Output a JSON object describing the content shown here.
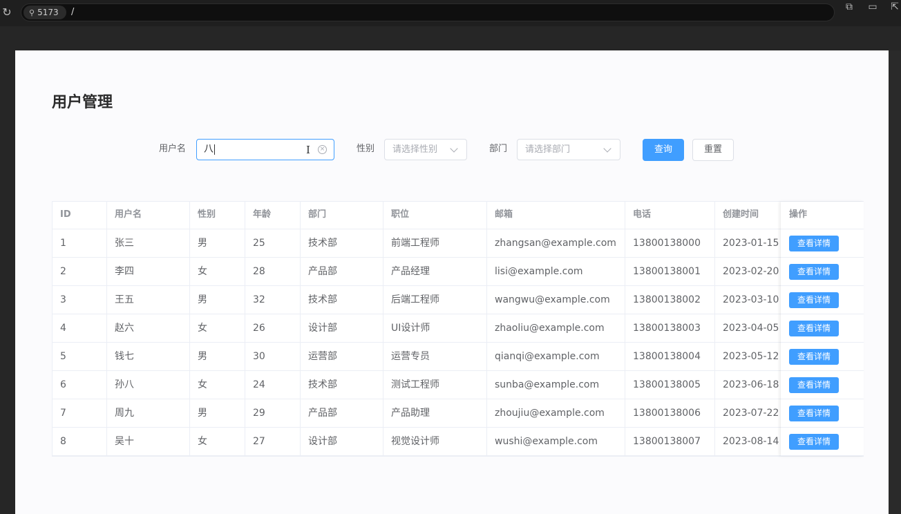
{
  "browser": {
    "port_chip": "5173",
    "path": "/"
  },
  "page": {
    "title": "用户管理"
  },
  "filters": {
    "username_label": "用户名",
    "username_value": "八",
    "gender_label": "性别",
    "gender_placeholder": "请选择性别",
    "dept_label": "部门",
    "dept_placeholder": "请选择部门",
    "search_label": "查询",
    "reset_label": "重置"
  },
  "table": {
    "columns": [
      "ID",
      "用户名",
      "性别",
      "年龄",
      "部门",
      "职位",
      "邮箱",
      "电话",
      "创建时间",
      "操作"
    ],
    "action_label": "查看详情",
    "rows": [
      [
        "1",
        "张三",
        "男",
        "25",
        "技术部",
        "前端工程师",
        "zhangsan@example.com",
        "13800138000",
        "2023-01-15"
      ],
      [
        "2",
        "李四",
        "女",
        "28",
        "产品部",
        "产品经理",
        "lisi@example.com",
        "13800138001",
        "2023-02-20"
      ],
      [
        "3",
        "王五",
        "男",
        "32",
        "技术部",
        "后端工程师",
        "wangwu@example.com",
        "13800138002",
        "2023-03-10"
      ],
      [
        "4",
        "赵六",
        "女",
        "26",
        "设计部",
        "UI设计师",
        "zhaoliu@example.com",
        "13800138003",
        "2023-04-05"
      ],
      [
        "5",
        "钱七",
        "男",
        "30",
        "运营部",
        "运营专员",
        "qianqi@example.com",
        "13800138004",
        "2023-05-12"
      ],
      [
        "6",
        "孙八",
        "女",
        "24",
        "技术部",
        "测试工程师",
        "sunba@example.com",
        "13800138005",
        "2023-06-18"
      ],
      [
        "7",
        "周九",
        "男",
        "29",
        "产品部",
        "产品助理",
        "zhoujiu@example.com",
        "13800138006",
        "2023-07-22"
      ],
      [
        "8",
        "吴十",
        "女",
        "27",
        "设计部",
        "视觉设计师",
        "wushi@example.com",
        "13800138007",
        "2023-08-14"
      ]
    ]
  },
  "colors": {
    "primary": "#409eff",
    "border": "#ebeef5",
    "header_text": "#909399",
    "body_text": "#606266"
  }
}
